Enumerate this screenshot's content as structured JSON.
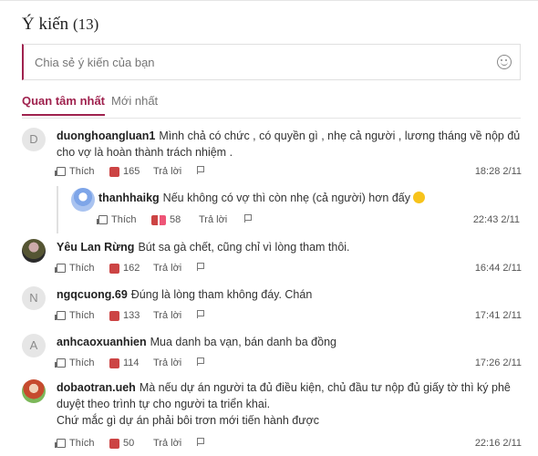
{
  "header": {
    "title": "Ý kiến",
    "count": "(13)"
  },
  "composer": {
    "placeholder": "Chia sẻ ý kiến của bạn",
    "icon": "smiley-icon"
  },
  "tabs": [
    {
      "label": "Quan tâm nhất"
    },
    {
      "label": "Mới nhất"
    }
  ],
  "actions_labels": {
    "like": "Thích",
    "reply": "Trả lời"
  },
  "comments": [
    {
      "avatar": "D",
      "user": "duonghoangluan1",
      "text": "Mình chả có chức , có quyền gì , nhẹ cả người , lương tháng về nộp đủ cho vợ là hoàn thành trách nhiệm .",
      "reactions": "165",
      "time": "18:28 2/11"
    },
    {
      "avatar": "",
      "user": "Yêu Lan Rừng",
      "text": "Bút sa gà chết, cũng chỉ vì lòng tham thôi.",
      "reactions": "162",
      "time": "16:44 2/11"
    },
    {
      "avatar": "N",
      "user": "ngqcuong.69",
      "text": "Đúng là lòng tham không đáy. Chán",
      "reactions": "133",
      "time": "17:41 2/11"
    },
    {
      "avatar": "A",
      "user": "anhcaoxuanhien",
      "text": "Mua danh ba vạn, bán danh ba đồng",
      "reactions": "114",
      "time": "17:26 2/11"
    },
    {
      "avatar": "",
      "user": "dobaotran.ueh",
      "text": "Mà nếu dự án người ta đủ điều kiện, chủ đầu tư nộp đủ giấy tờ thì ký phê duyệt theo trình tự cho người ta triển khai.",
      "text2": "Chứ mắc gì dự án phải bôi trơn mới tiến hành được",
      "reactions": "50",
      "time": "22:16 2/11"
    }
  ],
  "reply": {
    "user": "thanhhaikg",
    "text": "Nếu không có vợ thì còn nhẹ (cả người) hơn đấy",
    "reactions": "58",
    "time": "22:43 2/11"
  }
}
